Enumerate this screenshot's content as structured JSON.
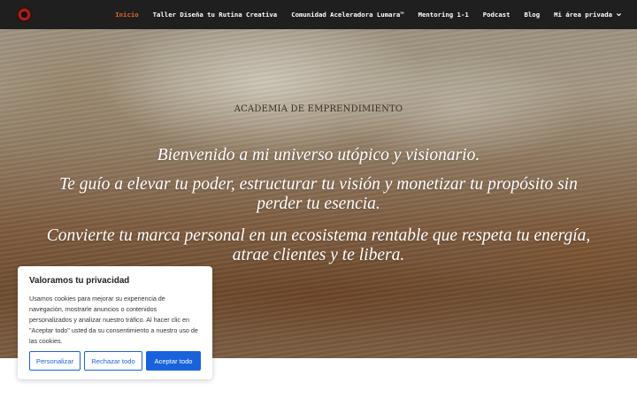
{
  "nav": {
    "items": [
      {
        "label": "Inicio",
        "active": true
      },
      {
        "label": "Taller Diseña tu Rutina Creativa",
        "active": false
      },
      {
        "label": "Comunidad Aceleradora Lumara™",
        "active": false
      },
      {
        "label": "Mentoring 1-1",
        "active": false
      },
      {
        "label": "Podcast",
        "active": false
      },
      {
        "label": "Blog",
        "active": false
      },
      {
        "label": "Mi área privada",
        "active": false,
        "dropdown": true
      }
    ],
    "active_color": "#e8622c"
  },
  "hero": {
    "kicker": "ACADEMIA DE EMPRENDIMIENTO",
    "line1": "Bienvenido a mi universo utópico y visionario.",
    "line2": "Te guío a elevar tu poder, estructurar tu visión y monetizar tu propósito sin perder tu esencia.",
    "line3": "Convierte tu marca personal en un ecosistema rentable que respeta tu energía, atrae clientes y te libera."
  },
  "cookie": {
    "title": "Valoramos tu privacidad",
    "text": "Usamos cookies para mejorar su experiencia de navegación, mostrarle anuncios o contenidos personalizados y analizar nuestro tráfico. Al hacer clic en \"Aceptar todo\" usted da su consentimiento a nuestro uso de las cookies.",
    "customize_label": "Personalizar",
    "reject_label": "Rechazar todo",
    "accept_label": "Aceptar todo",
    "accent_color": "#1863dc"
  },
  "icons": {
    "logo": "logo-icon",
    "dropdown": "chevron-down-icon"
  }
}
